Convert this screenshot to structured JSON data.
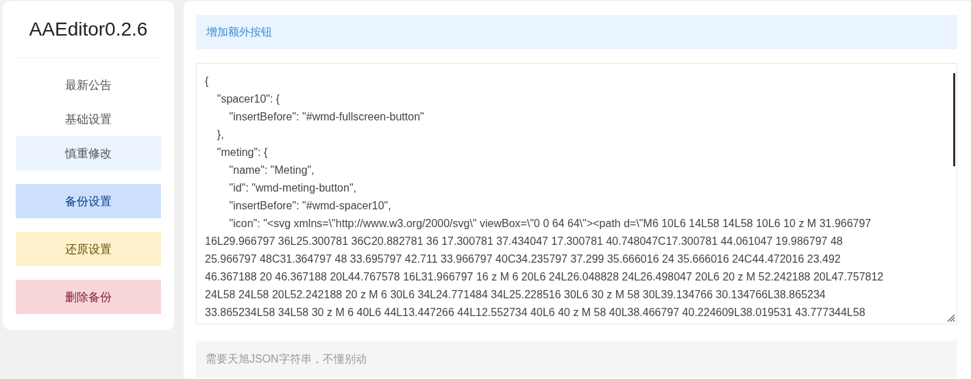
{
  "sidebar": {
    "title": "AAEditor0.2.6",
    "nav": [
      {
        "label": "最新公告",
        "selected": false
      },
      {
        "label": "基础设置",
        "selected": false
      },
      {
        "label": "慎重修改",
        "selected": true
      }
    ],
    "actions": [
      {
        "label": "备份设置",
        "kind": "primary"
      },
      {
        "label": "还原设置",
        "kind": "warning"
      },
      {
        "label": "删除备份",
        "kind": "danger"
      }
    ]
  },
  "main": {
    "section_title": "增加额外按钮",
    "editor_lines": [
      "{",
      "    \"spacer10\": {",
      "        \"insertBefore\": \"#wmd-fullscreen-button\"",
      "    },",
      "    \"meting\": {",
      "        \"name\": \"Meting\",",
      "        \"id\": \"wmd-meting-button\",",
      "        \"insertBefore\": \"#wmd-spacer10\",",
      "        \"icon\": \"<svg xmlns=\\\"http://www.w3.org/2000/svg\\\" viewBox=\\\"0 0 64 64\\\"><path d=\\\"M6 10L6 14L58 14L58 10L6 10 z M 31.966797",
      "16L29.966797 36L25.300781 36C20.882781 36 17.300781 37.434047 17.300781 40.748047C17.300781 44.061047 19.986797 48",
      "25.966797 48C31.364797 48 33.695797 42.711 33.966797 40C34.235797 37.299 35.666016 24 35.666016 24C44.472016 23.492",
      "46.367188 20 46.367188 20L44.767578 16L31.966797 16 z M 6 20L6 24L26.048828 24L26.498047 20L6 20 z M 52.242188 20L47.757812",
      "24L58 24L58 20L52.242188 20 z M 6 30L6 34L24.771484 34L25.228516 30L6 30 z M 58 30L39.134766 30.134766L38.865234",
      "33.865234L58 34L58 30 z M 6 40L6 44L13.447266 44L12.552734 40L6 40 z M 58 40L38.466797 40.224609L38.019531 43.777344L58"
    ],
    "hint": {
      "placeholder": "需要天旭JSON字符串，不懂别动"
    }
  }
}
